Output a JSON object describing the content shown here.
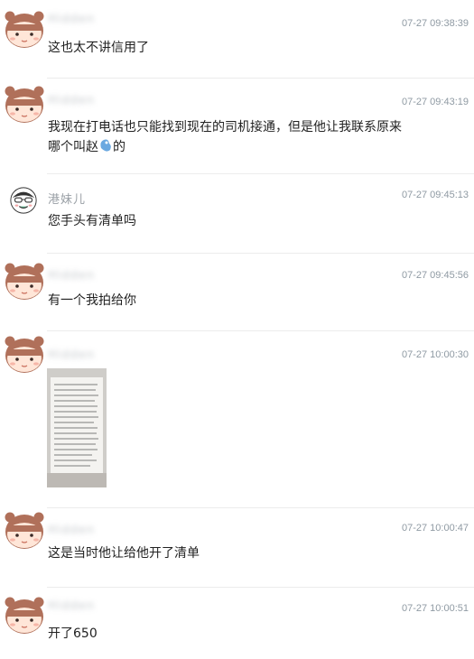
{
  "messages": [
    {
      "sender": "Hidden",
      "time": "07-27 09:38:39",
      "text": "这也太不讲信用了"
    },
    {
      "sender": "Hidden",
      "time": "07-27 09:43:19",
      "text": "我现在打电话也只能找到现在的司机接通，但是他让我联系原来",
      "text2": "哪个叫赵",
      "text2b": "的"
    },
    {
      "sender": "港妹儿",
      "time": "07-27 09:45:13",
      "text": "您手头有清单吗"
    },
    {
      "sender": "Hidden",
      "time": "07-27 09:45:56",
      "text": "有一个我拍给你"
    },
    {
      "sender": "Hidden",
      "time": "07-27 10:00:30",
      "text": ""
    },
    {
      "sender": "Hidden",
      "time": "07-27 10:00:47",
      "text": "这是当时他让给他开了清单"
    },
    {
      "sender": "Hidden",
      "time": "07-27 10:00:51",
      "text": "开了650"
    }
  ],
  "icons": {
    "avatar": "girl-avatar-icon",
    "avatar_alt": "cartoon-avatar-icon",
    "emoji": "blue-sticker-icon",
    "photo": "photo-thumbnail"
  },
  "colors": {
    "timestamp": "#8f9aa3",
    "separator": "#ececec",
    "hair": "#b0705a",
    "face": "#ffe6d8"
  }
}
